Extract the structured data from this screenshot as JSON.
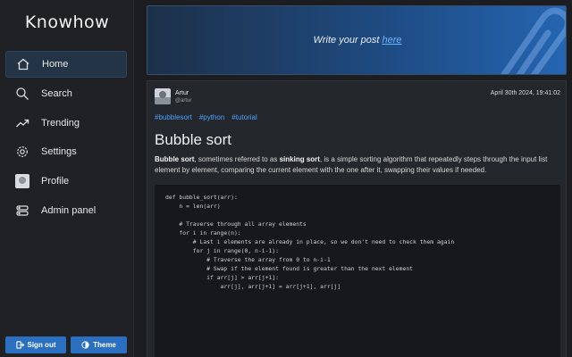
{
  "app": {
    "name": "Knowhow"
  },
  "sidebar": {
    "items": [
      {
        "label": "Home",
        "icon": "home-icon",
        "active": true
      },
      {
        "label": "Search",
        "icon": "search-icon"
      },
      {
        "label": "Trending",
        "icon": "trending-icon"
      },
      {
        "label": "Settings",
        "icon": "gear-icon"
      },
      {
        "label": "Profile",
        "icon": "avatar-icon"
      },
      {
        "label": "Admin panel",
        "icon": "admin-icon"
      }
    ],
    "signout_label": "Sign out",
    "theme_label": "Theme",
    "button_color": "#2a6fc0"
  },
  "banner": {
    "text": "Write your post",
    "link": "here"
  },
  "post": {
    "author": "Artur",
    "handle": "@artur",
    "date": "April 30th 2024, 19:41:02",
    "tags": [
      "#bubblesort",
      "#python",
      "#tutorial"
    ],
    "title": "Bubble sort",
    "desc_term": "Bubble sort",
    "desc_part1": ", sometimes referred to as ",
    "desc_term2": "sinking sort",
    "desc_part2": ", is a simple sorting algorithm that repeatedly steps through the input list element by element, comparing the current element with the one after it, swapping their values if needed.",
    "code_lines": [
      "def bubble_sort(arr):",
      "    n = len(arr)",
      "",
      "    # Traverse through all array elements",
      "    for i in range(n):",
      "        # Last i elements are already in place, so we don't need to check them again",
      "        for j in range(0, n-i-1):",
      "            # Traverse the array from 0 to n-i-1",
      "            # Swap if the element found is greater than the next element",
      "            if arr[j] > arr[j+1]:",
      "                arr[j], arr[j+1] = arr[j+1], arr[j]"
    ]
  },
  "colors": {
    "accent": "#2a6fc0",
    "link": "#4aa3ff",
    "background": "#1b1d20"
  }
}
